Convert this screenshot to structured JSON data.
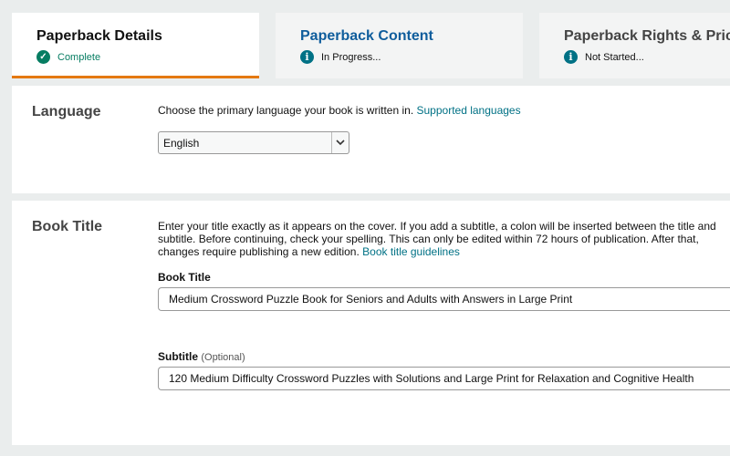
{
  "tabs": [
    {
      "title": "Paperback Details",
      "status": "Complete"
    },
    {
      "title": "Paperback Content",
      "status": "In Progress..."
    },
    {
      "title": "Paperback Rights & Pricing",
      "status": "Not Started..."
    }
  ],
  "language": {
    "heading": "Language",
    "description": "Choose the primary language your book is written in.",
    "link": "Supported languages",
    "selected": "English"
  },
  "book_title": {
    "heading": "Book Title",
    "description": "Enter your title exactly as it appears on the cover. If you add a subtitle, a colon will be inserted between the title and subtitle. Before continuing, check your spelling. This can only be edited within 72 hours of publication. After that, changes require publishing a new edition.",
    "link": "Book title guidelines",
    "title_label": "Book Title",
    "title_value": "Medium Crossword Puzzle Book for Seniors and Adults with Answers in Large Print",
    "subtitle_label": "Subtitle",
    "subtitle_optional": "(Optional)",
    "subtitle_value": "120 Medium Difficulty Crossword Puzzles with Solutions and Large Print for Relaxation and Cognitive Health"
  },
  "colors": {
    "accent_tab": "#e47911",
    "link": "#007185",
    "complete": "#067d62",
    "active_tab_title": "#0f5d9c"
  }
}
